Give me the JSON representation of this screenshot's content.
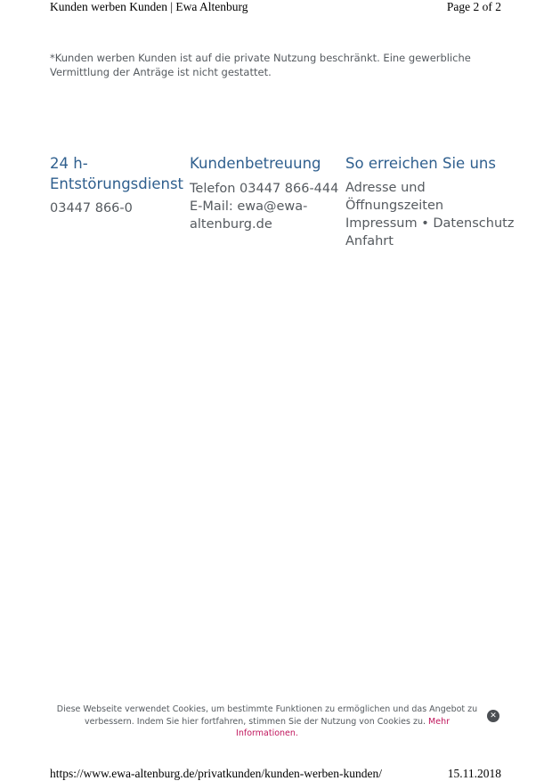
{
  "print_header": {
    "title": "Kunden werben Kunden | Ewa Altenburg",
    "page": "Page 2 of 2"
  },
  "disclaimer": "*Kunden werben Kunden ist auf die private Nutzung beschränkt. Eine gewerbliche Vermittlung der Anträge ist nicht gestattet.",
  "footer": {
    "emergency": {
      "title": "24 h-Entstörungsdienst",
      "phone": "03447 866-0"
    },
    "service": {
      "title": "Kundenbetreuung",
      "phone": "Telefon 03447 866-444",
      "email": "E-Mail: ewa@ewa-altenburg.de"
    },
    "contact": {
      "title": "So erreichen Sie uns",
      "address_link": "Adresse und Öffnungszeiten",
      "impressum_link": "Impressum",
      "separator": "•",
      "privacy_link": "Datenschutz",
      "directions_link": "Anfahrt"
    }
  },
  "cookie_notice": {
    "text": "Diese Webseite verwendet Cookies, um bestimmte Funktionen zu ermöglichen und das Angebot zu verbessern. Indem Sie hier fortfahren, stimmen Sie der Nutzung von Cookies zu.",
    "more_link": "Mehr Informationen.",
    "close_icon": "close-circle-icon"
  },
  "print_footer": {
    "url": "https://www.ewa-altenburg.de/privatkunden/kunden-werben-kunden/",
    "date": "15.11.2018"
  }
}
